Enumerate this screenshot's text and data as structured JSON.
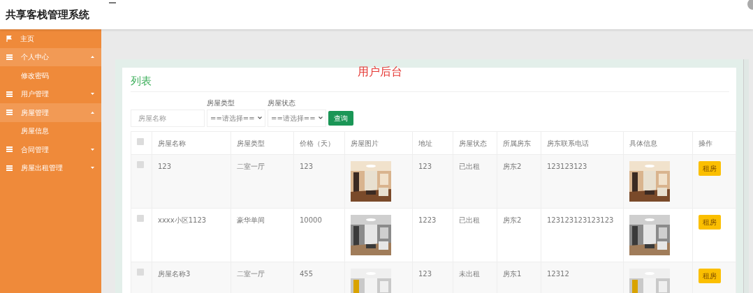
{
  "header": {
    "title": "共享客栈管理系统"
  },
  "sidebar": {
    "items": [
      {
        "label": "主页"
      },
      {
        "label": "个人中心",
        "expanded": true,
        "children": [
          {
            "label": "修改密码"
          }
        ]
      },
      {
        "label": "用户管理",
        "expanded": false
      },
      {
        "label": "房屋管理",
        "expanded": true,
        "children": [
          {
            "label": "房屋信息"
          }
        ]
      },
      {
        "label": "合同管理",
        "expanded": false
      },
      {
        "label": "房屋出租管理",
        "expanded": false
      }
    ]
  },
  "banner": "用户后台",
  "panel": {
    "title": "列表",
    "filters": {
      "name": {
        "placeholder": "房屋名称"
      },
      "type": {
        "label": "房屋类型",
        "value": "==请选择=="
      },
      "status": {
        "label": "房屋状态",
        "value": "==请选择=="
      },
      "search_button": "查询"
    },
    "table": {
      "select_all": {
        "checked": false
      },
      "columns": [
        "房屋名称",
        "房屋类型",
        "价格（天）",
        "房屋图片",
        "地址",
        "房屋状态",
        "所属房东",
        "房东联系电话",
        "具体信息",
        "操作"
      ],
      "rows": [
        {
          "checked": false,
          "name": "123",
          "type": "二室一厅",
          "price": "123",
          "address": "123",
          "status": "已出租",
          "landlord": "房东2",
          "phone": "123123123",
          "action": "租房"
        },
        {
          "checked": false,
          "name": "xxxx小区1123",
          "type": "豪华单间",
          "price": "10000",
          "address": "1223",
          "status": "已出租",
          "landlord": "房东2",
          "phone": "123123123123123",
          "action": "租房"
        },
        {
          "checked": false,
          "name": "房屋名称3",
          "type": "二室一厅",
          "price": "455",
          "address": "123",
          "status": "未出租",
          "landlord": "房东1",
          "phone": "12312",
          "action": "租房"
        }
      ]
    }
  }
}
